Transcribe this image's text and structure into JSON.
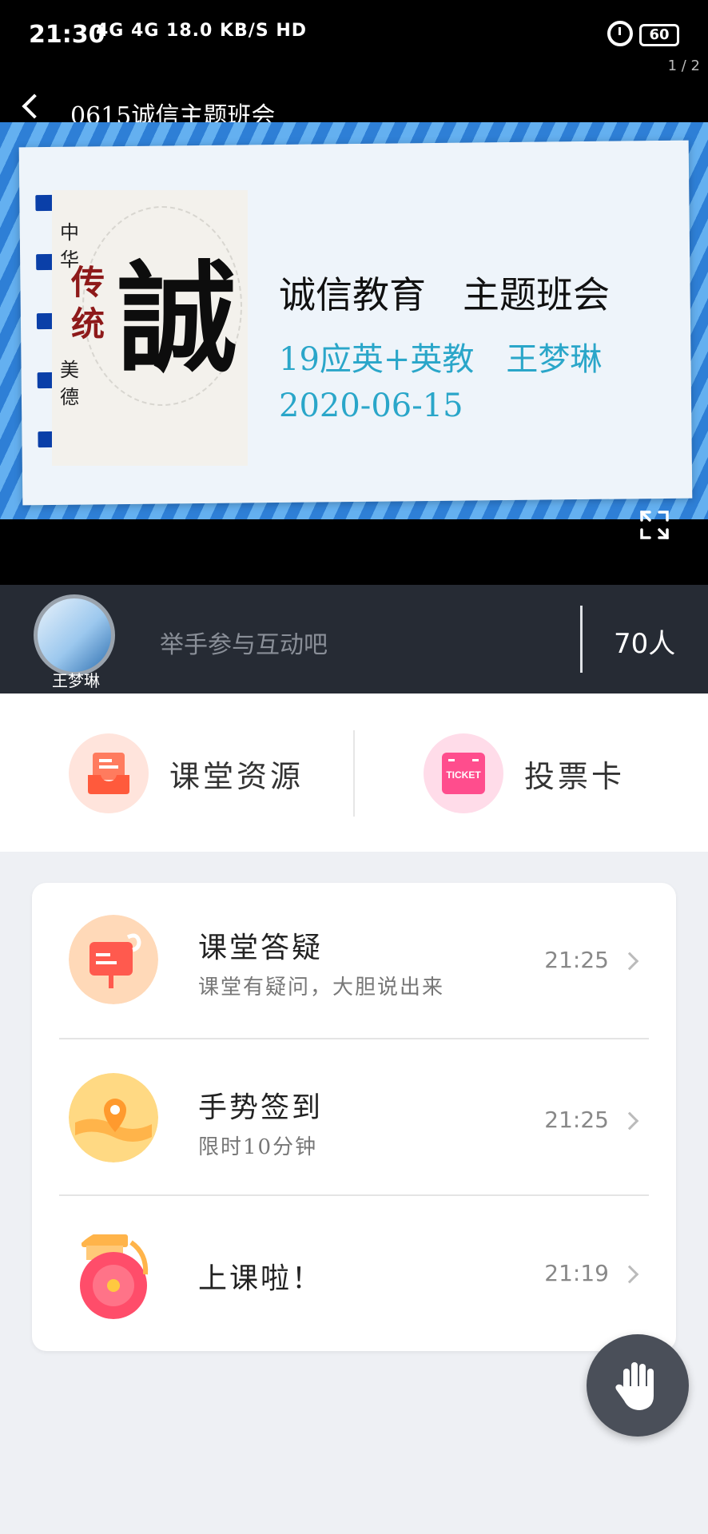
{
  "status_bar": {
    "time": "21:30",
    "network": "4G 4G 18.0 KB/S HD",
    "battery": "60",
    "page_indicator": "1 / 2"
  },
  "video": {
    "title": "0615诚信主题班会",
    "slide": {
      "art_big_char": "誠",
      "art_small_top": "中华",
      "art_red": "传统",
      "art_small_bottom": "美德",
      "heading": "诚信教育　主题班会",
      "line1": "19应英+英教　王梦琳",
      "line2": "2020-06-15"
    }
  },
  "live_bar": {
    "teacher_name": "王梦琳",
    "hint": "举手参与互动吧",
    "online_count": "70人"
  },
  "quick_actions": {
    "resources": {
      "label": "课堂资源",
      "icon": "inbox-tray-icon",
      "color": "#ff6f52"
    },
    "vote": {
      "label": "投票卡",
      "icon": "ticket-icon",
      "color": "#ff4d8d",
      "icon_text": "TICKET"
    }
  },
  "activities": [
    {
      "title": "课堂答疑",
      "subtitle": "课堂有疑问，大胆说出来",
      "time": "21:25",
      "icon": "question-board-icon"
    },
    {
      "title": "手势签到",
      "subtitle": "限时10分钟",
      "time": "21:25",
      "icon": "location-pin-icon"
    },
    {
      "title": "上课啦！",
      "subtitle": "",
      "time": "21:19",
      "icon": "bell-icon"
    }
  ],
  "fab": {
    "icon": "raise-hand-icon"
  },
  "colors": {
    "accent_teal": "#2aa6c9",
    "dark_bar": "#262b34",
    "page_bg": "#eef0f4"
  }
}
